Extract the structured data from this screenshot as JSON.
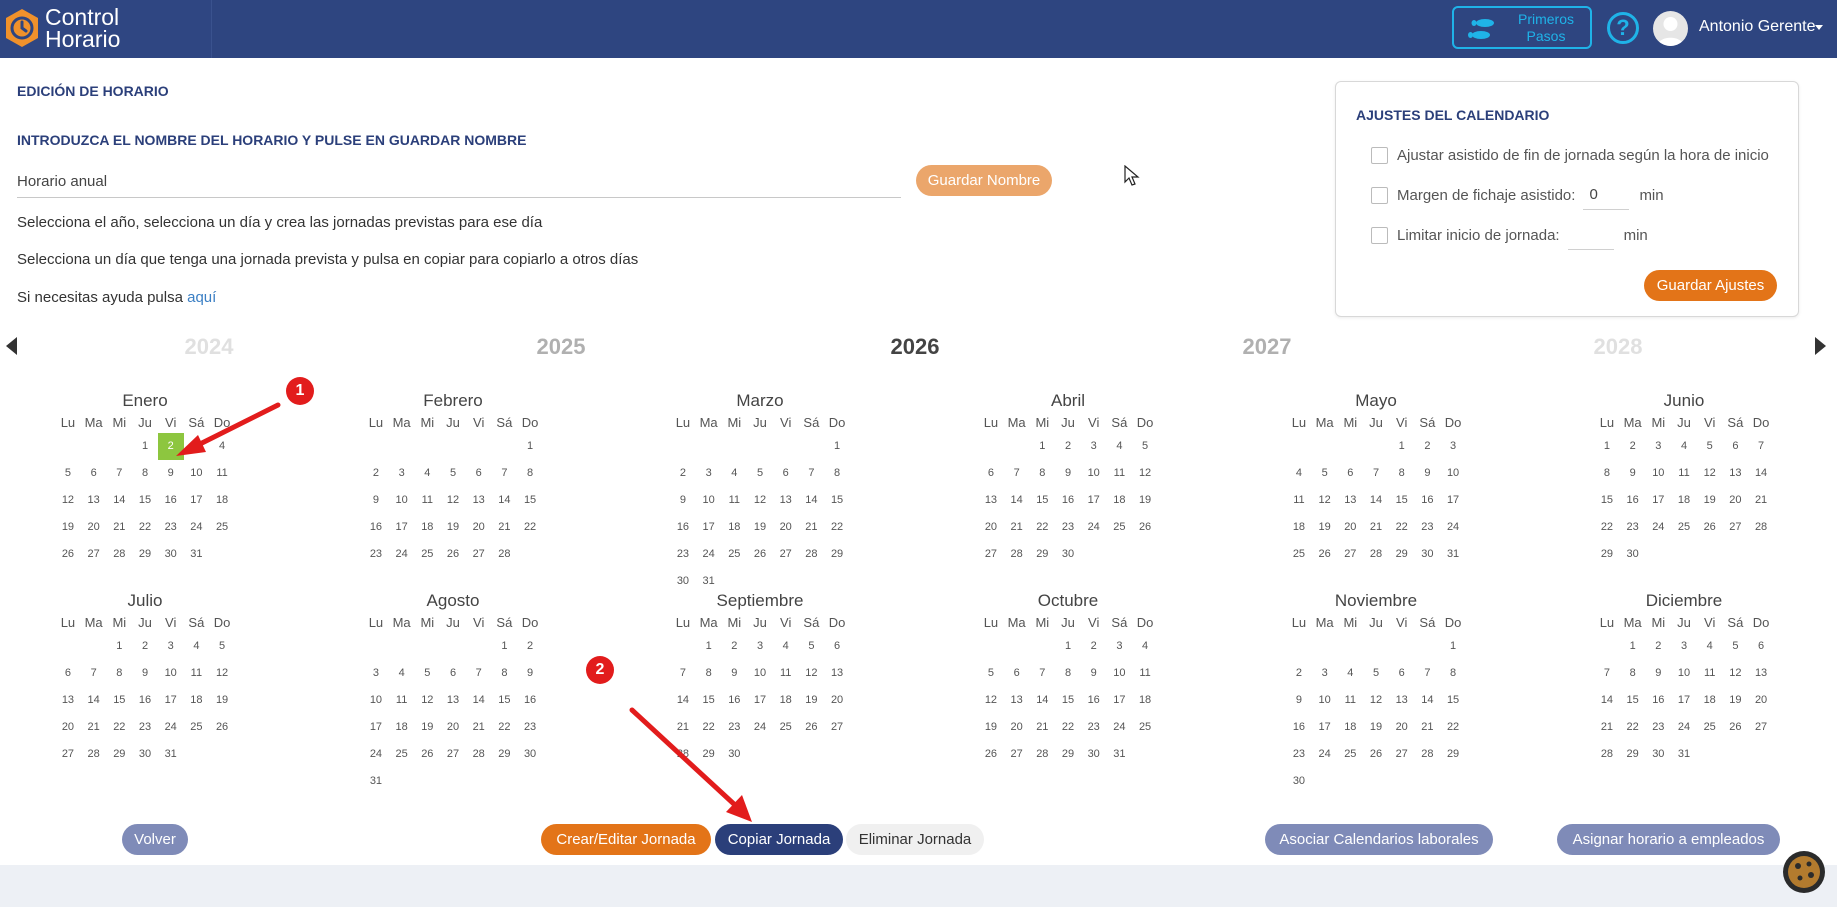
{
  "header": {
    "brand_line1": "Control",
    "brand_line2": "Horario",
    "primeros_line1": "Primeros",
    "primeros_line2": "Pasos",
    "help_symbol": "?",
    "user_name": "Antonio Gerente",
    "colors": {
      "bar": "#2e4580",
      "accent": "#1fb3e8",
      "logo": "#f0912b"
    }
  },
  "form": {
    "section_title": "EDICIÓN DE HORARIO",
    "name_prompt": "INTRODUZCA EL NOMBRE DEL HORARIO Y PULSE EN GUARDAR NOMBRE",
    "name_value": "Horario anual",
    "save_name_label": "Guardar Nombre",
    "info1": "Selecciona el año, selecciona un día y crea las jornadas previstas para ese día",
    "info2": "Selecciona un día que tenga una jornada prevista y pulsa en copiar para copiarlo a otros días",
    "help_text": "Si necesitas ayuda pulsa",
    "help_link": "aquí"
  },
  "settings": {
    "title": "AJUSTES DEL CALENDARIO",
    "opt1": "Ajustar asistido de fin de jornada según la hora de inicio",
    "opt2": "Margen de fichaje asistido:",
    "opt2_value": "0",
    "opt2_unit": "min",
    "opt3": "Limitar inicio de jornada:",
    "opt3_value": "",
    "opt3_unit": "min",
    "save_label": "Guardar Ajustes"
  },
  "years": [
    "2024",
    "2025",
    "2026",
    "2027",
    "2028"
  ],
  "weekdays": [
    "Lu",
    "Ma",
    "Mi",
    "Ju",
    "Vi",
    "Sá",
    "Do"
  ],
  "months": [
    {
      "name": "Enero",
      "offset": 3,
      "days": 31,
      "selected": 2
    },
    {
      "name": "Febrero",
      "offset": 6,
      "days": 28
    },
    {
      "name": "Marzo",
      "offset": 6,
      "days": 31
    },
    {
      "name": "Abril",
      "offset": 2,
      "days": 30
    },
    {
      "name": "Mayo",
      "offset": 4,
      "days": 31
    },
    {
      "name": "Junio",
      "offset": 0,
      "days": 30
    },
    {
      "name": "Julio",
      "offset": 2,
      "days": 31
    },
    {
      "name": "Agosto",
      "offset": 5,
      "days": 31
    },
    {
      "name": "Septiembre",
      "offset": 1,
      "days": 30
    },
    {
      "name": "Octubre",
      "offset": 3,
      "days": 31
    },
    {
      "name": "Noviembre",
      "offset": 6,
      "days": 30
    },
    {
      "name": "Diciembre",
      "offset": 1,
      "days": 31
    }
  ],
  "buttons": {
    "volver": "Volver",
    "crear": "Crear/Editar Jornada",
    "copiar": "Copiar Jornada",
    "eliminar": "Eliminar Jornada",
    "asociar": "Asociar Calendarios laborales",
    "asignar": "Asignar horario a empleados"
  },
  "annotations": {
    "badge1": "1",
    "badge2": "2"
  },
  "colors": {
    "selected_day": "#8dc63f",
    "annotation": "#e21c1c"
  }
}
